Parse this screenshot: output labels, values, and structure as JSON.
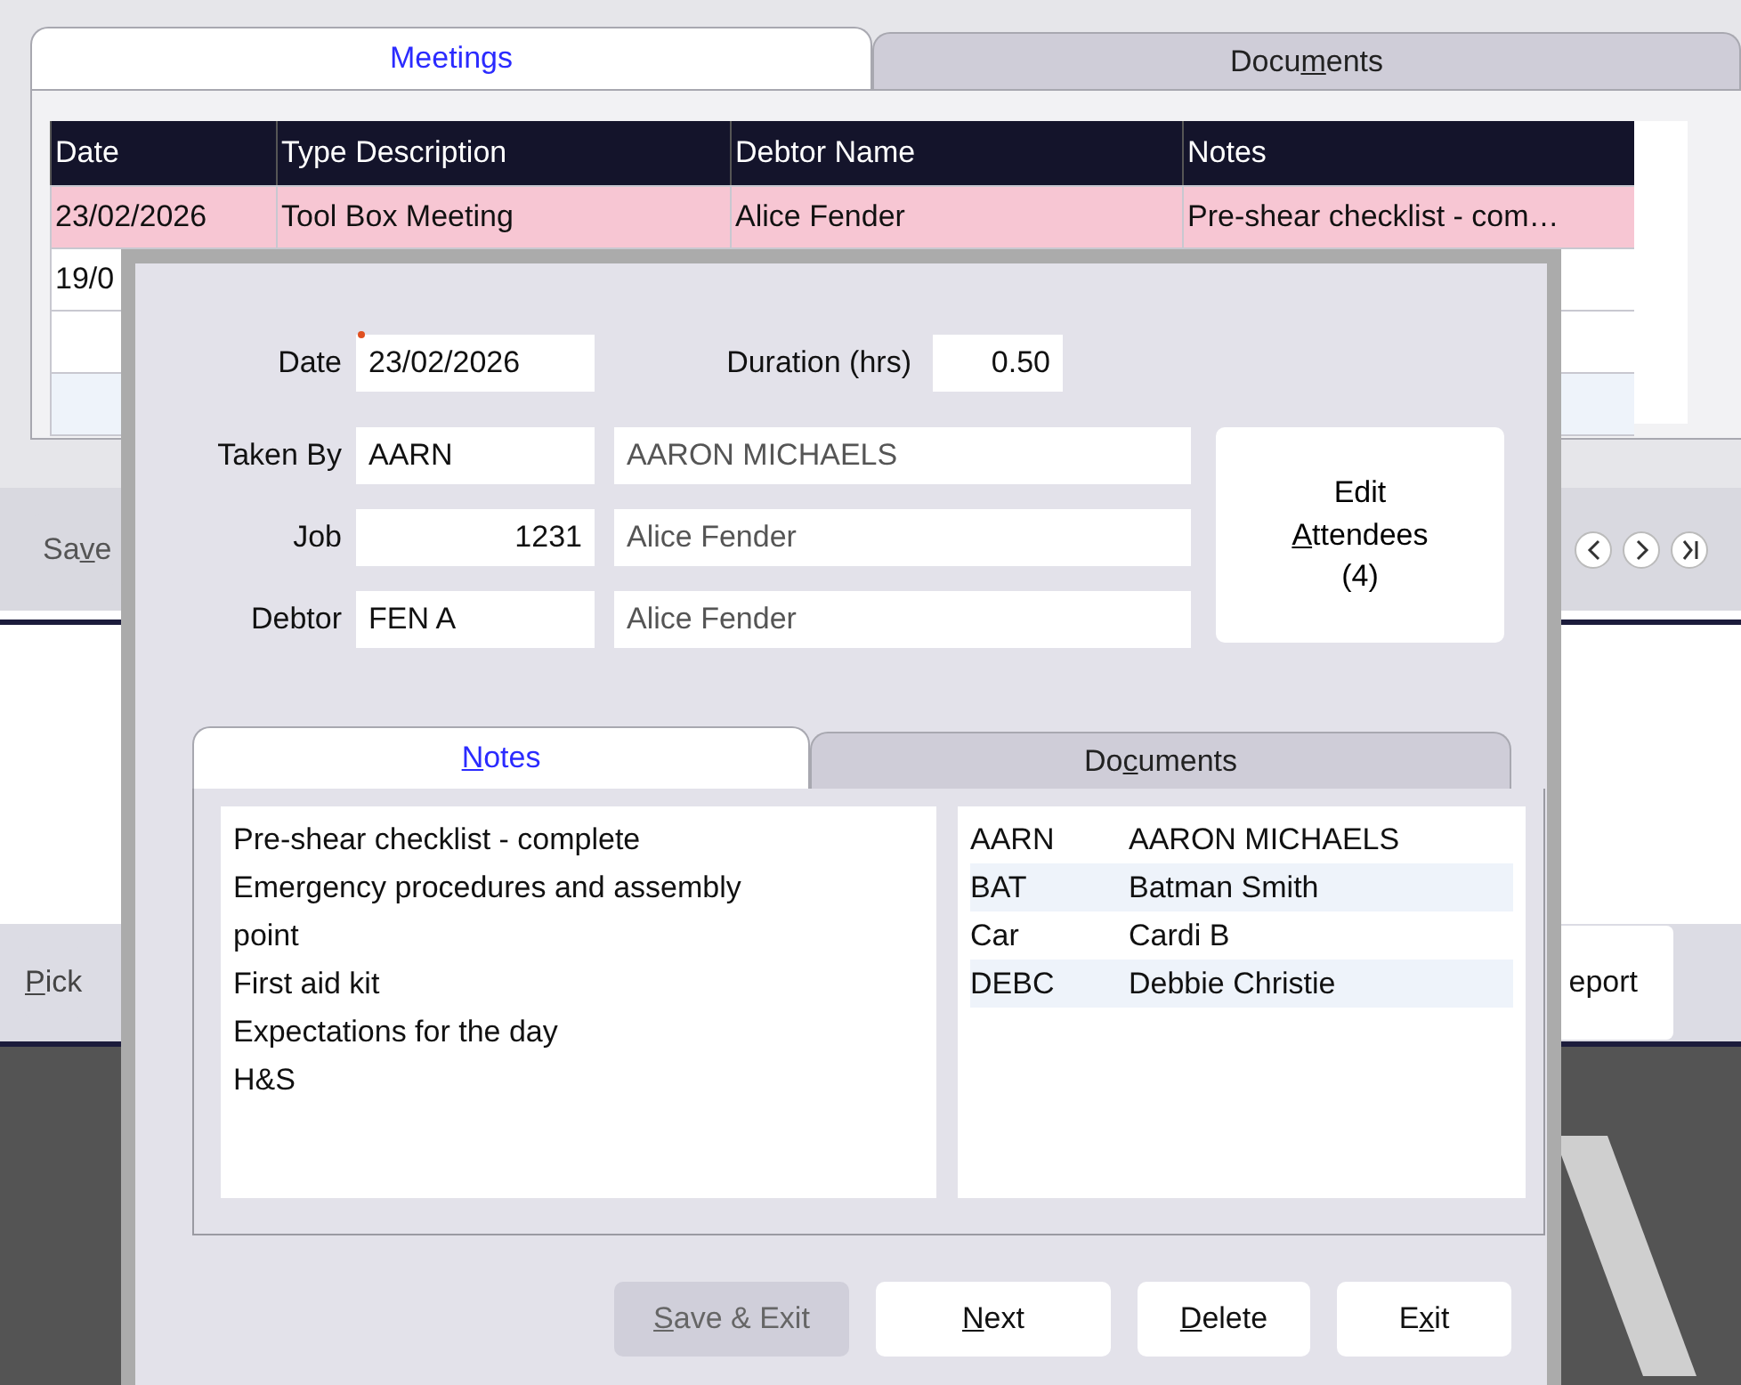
{
  "main_tabs": [
    {
      "label": "Meetings",
      "selected": true
    },
    {
      "label": "Documents",
      "selected": false
    }
  ],
  "meetings_table": {
    "columns": [
      "Date",
      "Type Description",
      "Debtor Name",
      "Notes"
    ],
    "rows": [
      {
        "cells": [
          "23/02/2026",
          "Tool Box Meeting",
          "Alice Fender",
          "Pre-shear checklist - com…"
        ],
        "selected": true
      },
      {
        "cells": [
          "19/0"
        ],
        "selected": false
      },
      {
        "cells": [],
        "selected": false
      },
      {
        "cells": [],
        "selected": false
      }
    ]
  },
  "toolbar": {
    "save_button": {
      "label": "Save"
    }
  },
  "lower_bar": {
    "pick_button": {
      "label": "Pick"
    },
    "report_button": {
      "label": "eport"
    }
  },
  "dialog": {
    "date": {
      "label": "Date",
      "value": "23/02/2026"
    },
    "duration": {
      "label": "Duration (hrs)",
      "value": "0.50"
    },
    "fields": [
      {
        "label": "Taken By",
        "code": "AARN",
        "name": "AARON MICHAELS",
        "kind": "text"
      },
      {
        "label": "Job",
        "code": "1231",
        "name": "Alice Fender",
        "kind": "number"
      },
      {
        "label": "Debtor",
        "code": "FEN A",
        "name": "Alice Fender",
        "kind": "text"
      }
    ],
    "attendees_button": {
      "label": "Edit Attendees (4)"
    },
    "tabs": [
      {
        "label": "Notes",
        "selected": true
      },
      {
        "label": "Documents",
        "selected": false
      }
    ],
    "notes": [
      "Pre-shear checklist - complete",
      "Emergency procedures and assembly point",
      "First aid kit",
      "Expectations for the day",
      "H&S"
    ],
    "attendees": [
      {
        "code": "AARN",
        "name": "AARON MICHAELS"
      },
      {
        "code": "BAT",
        "name": "Batman Smith"
      },
      {
        "code": "Car",
        "name": "Cardi B"
      },
      {
        "code": "DEBC",
        "name": "Debbie Christie"
      }
    ],
    "buttons": [
      {
        "label": "Save & Exit",
        "disabled": true
      },
      {
        "label": "Next",
        "disabled": false
      },
      {
        "label": "Delete",
        "disabled": false
      },
      {
        "label": "Exit",
        "disabled": false
      }
    ]
  }
}
